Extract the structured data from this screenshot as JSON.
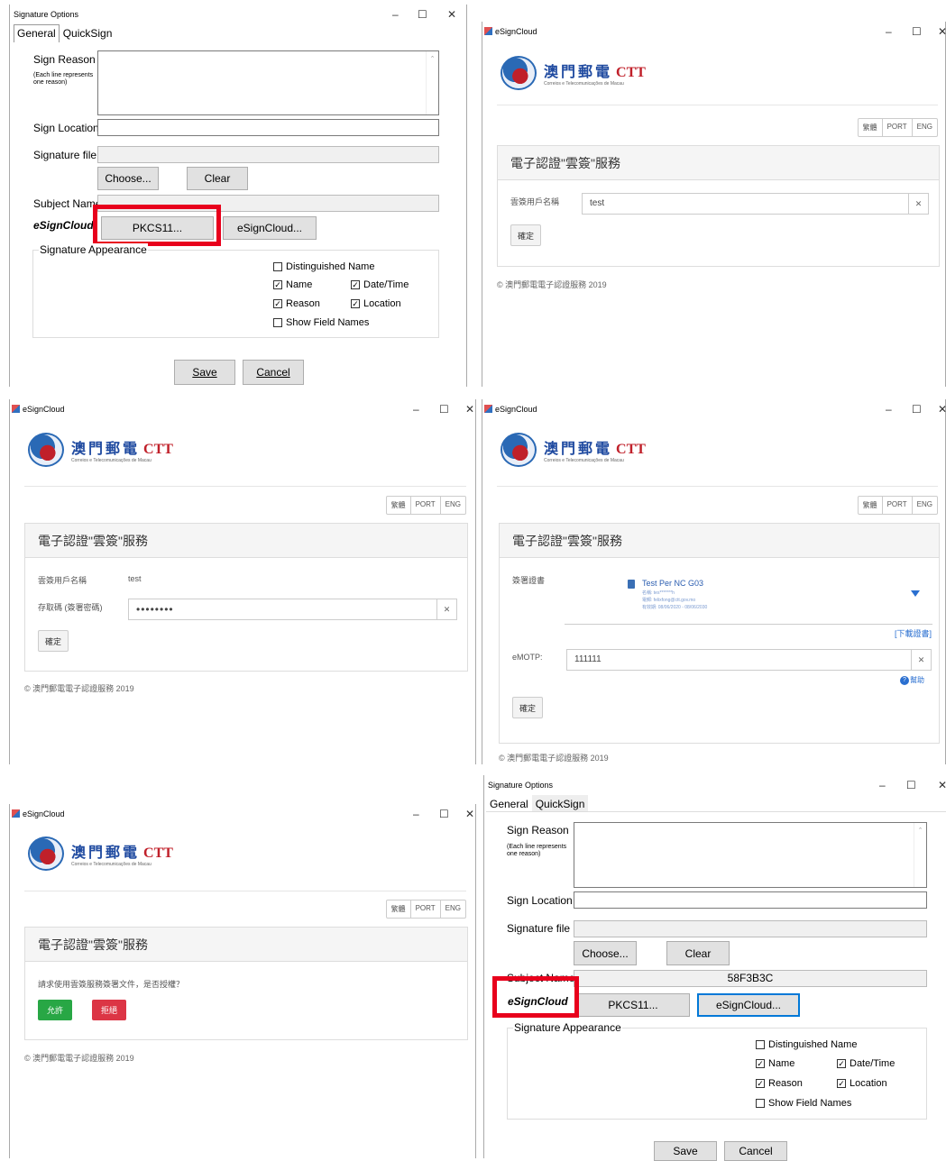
{
  "sigopts": {
    "title": "Signature Options",
    "tab_general": "General",
    "tab_quicksign": "QuickSign",
    "sign_reason": "Sign Reason",
    "reason_hint": "(Each line represents one reason)",
    "sign_location": "Sign Location",
    "signature_file": "Signature file",
    "choose": "Choose...",
    "clear": "Clear",
    "subject_name": "Subject Name",
    "esigncloud": "eSignCloud",
    "pkcs11": "PKCS11...",
    "esigncloud_btn": "eSignCloud...",
    "sig_appearance": "Signature Appearance",
    "distinguished_name": "Distinguished Name",
    "name": "Name",
    "date_time": "Date/Time",
    "reason": "Reason",
    "location": "Location",
    "show_field_names": "Show Field Names",
    "save": "Save",
    "cancel": "Cancel",
    "subject_value": "58F3B3C",
    "checks": {
      "distinguished_name": false,
      "name": true,
      "date_time": true,
      "reason": true,
      "location": true,
      "show_field_names": false
    }
  },
  "esign": {
    "title": "eSignCloud",
    "logo_zh": "澳門郵電",
    "logo_en": "CTT",
    "logo_sub": "Correios e Telecomunicações de Macau",
    "langs": [
      "繁體",
      "PORT",
      "ENG"
    ],
    "heading": "電子認證\"雲簽\"服務",
    "user_label": "雲簽用戶名稱",
    "user_value": "test",
    "pwd_label": "存取碼 (簽署密碼)",
    "pwd_value": "••••••••",
    "confirm": "確定",
    "footer": "© 澳門郵電電子認證服務 2019",
    "cert_label": "簽署證書",
    "cert_name": "Test Per NC G03",
    "cert_l1": "名稱: tes*******h",
    "cert_l2": "電郵: felixfong@ctt.gov.mo",
    "cert_l3": "有效期: 08/06/2020 - 08/06/2030",
    "download_cert": "[下載證書]",
    "emotp_label": "eMOTP:",
    "emotp_value": "111111",
    "help": "幫助",
    "auth_question": "請求使用雲簽服務簽署文件，是否授權？",
    "allow": "允許",
    "deny": "拒絕"
  },
  "window_controls": {
    "min": "–",
    "max": "☐",
    "close": "✕"
  }
}
